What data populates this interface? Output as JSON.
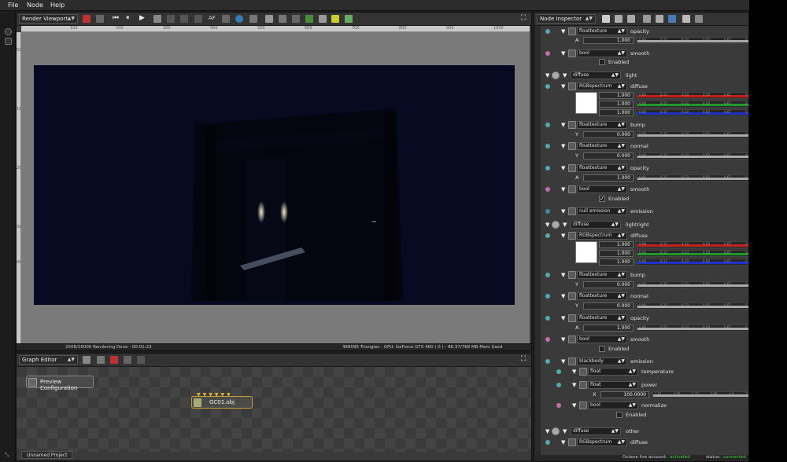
{
  "menu": {
    "file": "File",
    "node": "Node",
    "help": "Help"
  },
  "viewport": {
    "combo": "Render Viewport",
    "ruler_x": [
      "100",
      "200",
      "300",
      "400",
      "500",
      "600",
      "700",
      "800",
      "900",
      "1000"
    ],
    "ruler_y": [
      "50",
      "100",
      "200",
      "300",
      "400"
    ],
    "status_left": "2506/16000 Rendering Done - 00:01:23",
    "status_right": "468095 Triangles - GPU: GeForce GTX 460 ( 0 ) - 86.37/768 MB Mem Used"
  },
  "graph": {
    "combo": "Graph Editor",
    "preview_label": "Preview Configuration",
    "node_label": "GC01.obj",
    "tab_label": "Unnamed Project"
  },
  "inspector": {
    "combo": "Node Inspector",
    "ticks": [
      "0.00",
      "0.17",
      "0.33",
      "0.50",
      "0.67",
      "0.83"
    ],
    "power_ticks": [
      "1.61",
      "3.05",
      "3.22",
      "4.86",
      "4.6",
      "31.3"
    ],
    "floattexture": "floattexture",
    "bool": "bool",
    "rgbspectrum": "RGBspectrum",
    "diffuse": "diffuse",
    "float": "float",
    "opacity": "opacity",
    "smooth": "smooth",
    "enabled": "Enabled",
    "light": "light",
    "lightright": "lightright",
    "bump": "bump",
    "normal": "normal",
    "emission": "emission",
    "null_emission": "null emission",
    "blackbody": "blackbody",
    "temperature": "temperature",
    "power": "power",
    "normalize": "normalize",
    "other": "other",
    "val_1": "1.000",
    "val_0": "0.000",
    "power_val": "100.0000",
    "label_a": "A",
    "label_y": "Y",
    "label_x": "X"
  },
  "status": {
    "account_label": "Octane live account:",
    "account_value": "activated",
    "status_label": "status:",
    "status_value": "connected"
  },
  "colors": {
    "accent_node": "#c9a030",
    "red": "#c81e1e",
    "green": "#1e9a2a",
    "blue": "#2030c8",
    "activated": "#3fcf3f"
  }
}
